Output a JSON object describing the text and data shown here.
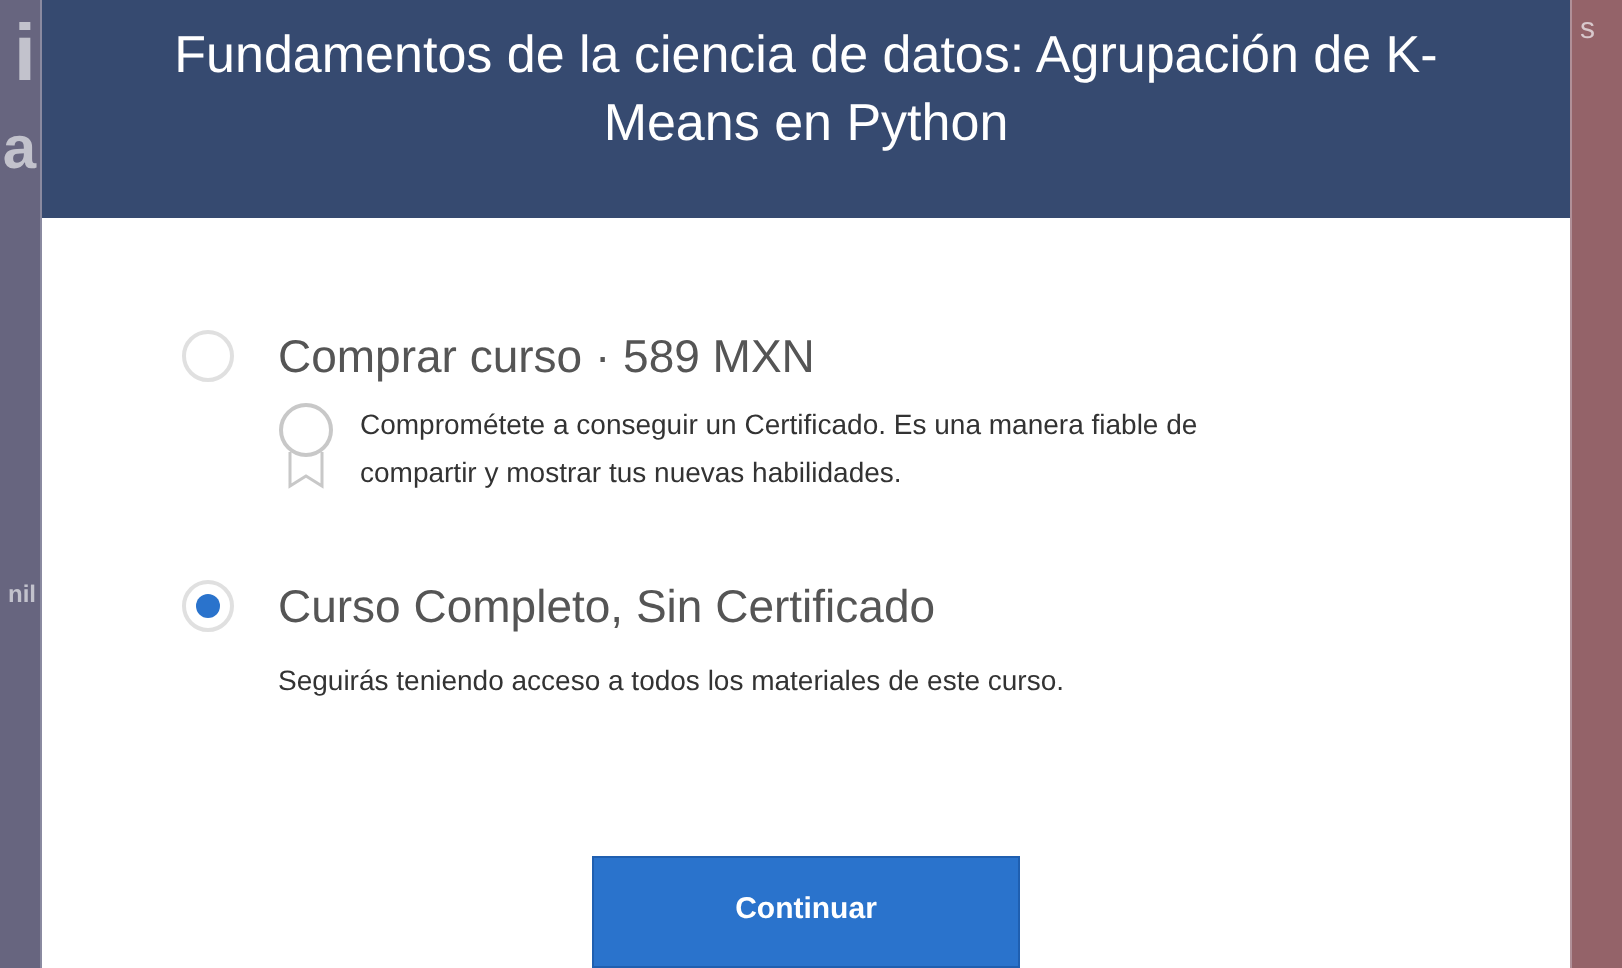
{
  "background": {
    "left_fragments": [
      "i",
      "a",
      "nil"
    ],
    "right_fragments": [
      "s"
    ]
  },
  "dialog": {
    "title": "Fundamentos de la ciencia de datos: Agrupación de K-Means en Python",
    "options": [
      {
        "label": "Comprar curso · 589 MXN",
        "description": "Comprométete a conseguir un Certificado. Es una manera fiable de compartir y mostrar tus nuevas habilidades.",
        "kind": "certificate",
        "selected": false
      },
      {
        "label": "Curso Completo, Sin Certificado",
        "description": "Seguirás teniendo acceso a todos los materiales de este curso.",
        "kind": "plain",
        "selected": true
      }
    ],
    "button": "Continuar"
  }
}
